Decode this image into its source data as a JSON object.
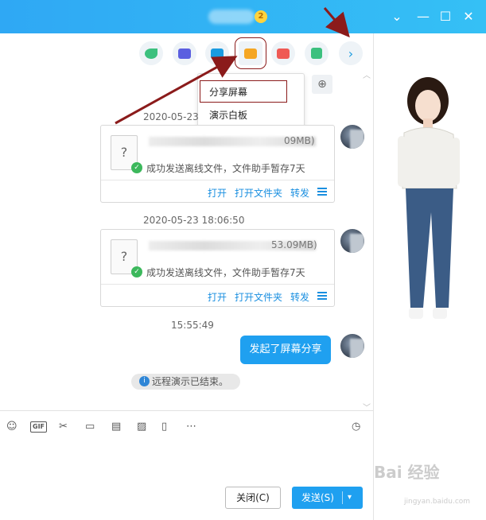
{
  "title_badge": "2",
  "window": {
    "minimize": "—",
    "maximize": "☐",
    "close": "✕",
    "extra": "⌄"
  },
  "toolbar": {
    "icons": [
      {
        "name": "phone-icon",
        "color": "#3cc07e"
      },
      {
        "name": "video-icon",
        "color": "#5b5fe0"
      },
      {
        "name": "add-icon",
        "color": "#1a9be0"
      },
      {
        "name": "share-screen-icon",
        "color": "#f5a623"
      },
      {
        "name": "present-icon",
        "color": "#ef5a55"
      },
      {
        "name": "apps-icon",
        "color": "#3cc07e"
      },
      {
        "name": "more-icon",
        "color": "#1a9be0"
      }
    ]
  },
  "share_menu": {
    "item1": "分享屏幕",
    "item2": "演示白板"
  },
  "messages": [
    {
      "time": "2020-05-23",
      "size": "09MB)",
      "status": "成功发送离线文件，文件助手暂存7天",
      "actions": [
        "打开",
        "打开文件夹",
        "转发"
      ]
    },
    {
      "time": "2020-05-23 18:06:50",
      "size": "53.09MB)",
      "status": "成功发送离线文件，文件助手暂存7天",
      "actions": [
        "打开",
        "打开文件夹",
        "转发"
      ]
    }
  ],
  "time3": "15:55:49",
  "bubble": "发起了屏幕分享",
  "notice": "远程演示已结束。",
  "file_glyph": "?",
  "input_toolbar": {
    "emoji": "☺",
    "gif": "GIF",
    "scissors": "✂",
    "folder": "▭",
    "clock": "◷",
    "more": "⋯"
  },
  "buttons": {
    "close": "关闭(C)",
    "send": "发送(S)",
    "send_dd": "▾"
  },
  "watermark": {
    "text": "Bai 经验",
    "url": "jingyan.baidu.com"
  }
}
